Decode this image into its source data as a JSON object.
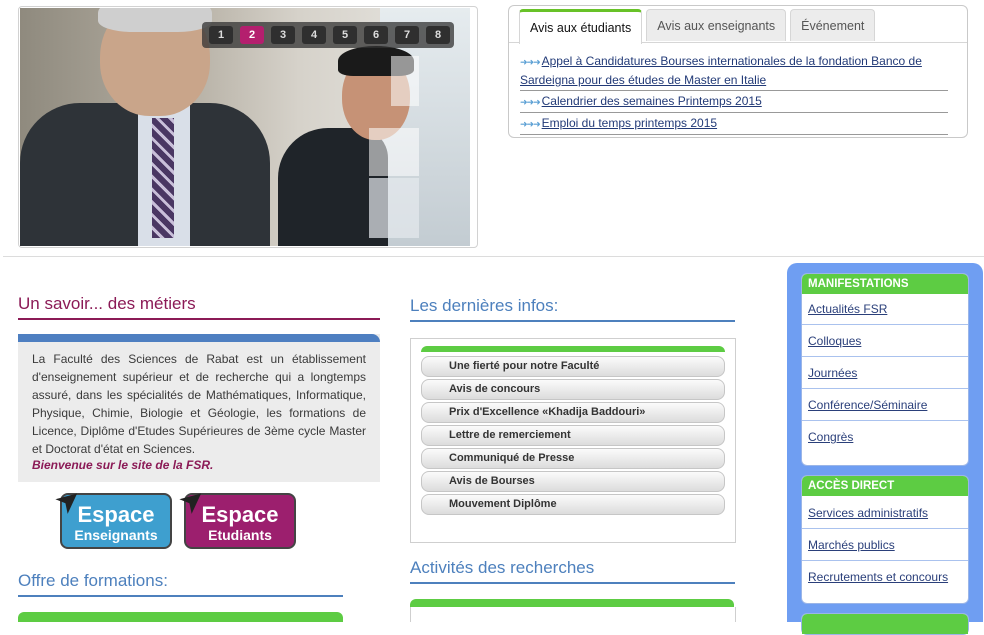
{
  "slider": {
    "pages": [
      "1",
      "2",
      "3",
      "4",
      "5",
      "6",
      "7",
      "8"
    ],
    "active_page": "2"
  },
  "tabs": {
    "items": [
      {
        "label": "Avis aux étudiants",
        "active": true
      },
      {
        "label": "Avis aux enseignants",
        "active": false
      },
      {
        "label": "Événement",
        "active": false
      }
    ],
    "news": [
      "Appel à Candidatures Bourses internationales de la fondation Banco de Sardeigna pour des études de Master en Italie",
      "Calendrier des semaines Printemps 2015",
      "Emploi du temps printemps 2015"
    ]
  },
  "left": {
    "title": "Un savoir... des métiers",
    "text": "La Faculté des Sciences de Rabat est un établissement d'enseignement supérieur et de recherche qui a longtemps assuré, dans les spécialités de Mathématiques, Informatique, Physique, Chimie, Biologie et Géologie, les formations de Licence, Diplôme d'Etudes Supérieures de 3ème cycle Master et Doctorat d'état en Sciences.",
    "welcome": "Bienvenue sur le site de la FSR.",
    "espace_enseignants": {
      "big": "Espace",
      "small": "Enseignants"
    },
    "espace_etudiants": {
      "big": "Espace",
      "small": "Etudiants"
    },
    "offre_title": "Offre de formations:"
  },
  "middle": {
    "infos_title": "Les dernières infos:",
    "infos": [
      "Une fierté pour notre Faculté",
      "Avis de concours",
      "Prix d'Excellence «Khadija Baddouri»",
      "Lettre de remerciement",
      "Communiqué de Presse",
      "Avis de Bourses",
      "Mouvement Diplôme"
    ],
    "activites_title": "Activités des recherches"
  },
  "right": {
    "manifestations": {
      "title": "MANIFESTATIONS",
      "links": [
        "Actualités FSR",
        "Colloques",
        "Journées",
        "Conférence/Séminaire",
        "Congrès"
      ]
    },
    "acces": {
      "title": "ACCÈS DIRECT",
      "links": [
        "Services administratifs",
        "Marchés publics",
        "Recrutements et concours"
      ]
    }
  },
  "colors": {
    "accent_green": "#5dcc43",
    "maroon": "#8b1a56",
    "heading_blue": "#4d80bd",
    "panel_blue": "#6f9ef2"
  }
}
